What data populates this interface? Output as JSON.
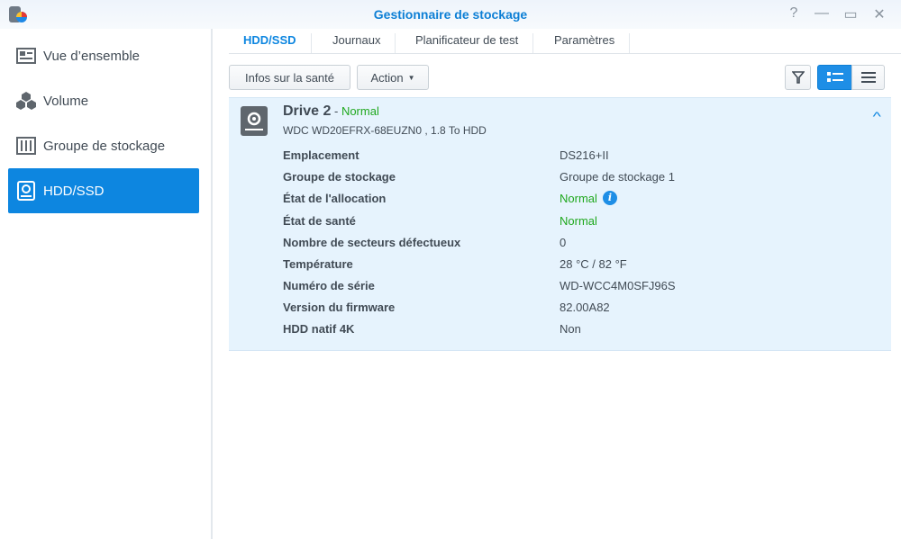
{
  "window": {
    "title": "Gestionnaire de stockage",
    "help": "?",
    "minimize": "—",
    "maximize": "▭",
    "close": "✕"
  },
  "sidebar": {
    "items": [
      {
        "label": "Vue d’ensemble"
      },
      {
        "label": "Volume"
      },
      {
        "label": "Groupe de stockage"
      },
      {
        "label": "HDD/SSD"
      }
    ]
  },
  "tabs": [
    {
      "label": "HDD/SSD"
    },
    {
      "label": "Journaux"
    },
    {
      "label": "Planificateur de test"
    },
    {
      "label": "Paramètres"
    }
  ],
  "toolbar": {
    "health_label": "Infos sur la santé",
    "action_label": "Action"
  },
  "drive": {
    "name": "Drive 2",
    "sep": " - ",
    "status": "Normal",
    "model": "WDC WD20EFRX-68EUZN0 , 1.8 To HDD",
    "details": [
      {
        "key": "Emplacement",
        "value": "DS216+II"
      },
      {
        "key": "Groupe de stockage",
        "value": "Groupe de stockage 1"
      },
      {
        "key": "État de l'allocation",
        "value": "Normal"
      },
      {
        "key": "État de santé",
        "value": "Normal"
      },
      {
        "key": "Nombre de secteurs défectueux",
        "value": "0"
      },
      {
        "key": "Température",
        "value": "28 °C / 82 °F"
      },
      {
        "key": "Numéro de série",
        "value": "WD-WCC4M0SFJ96S"
      },
      {
        "key": "Version du firmware",
        "value": "82.00A82"
      },
      {
        "key": "HDD natif 4K",
        "value": "Non"
      }
    ]
  },
  "colors": {
    "accent": "#0d86e0",
    "ok": "#20a81e"
  }
}
